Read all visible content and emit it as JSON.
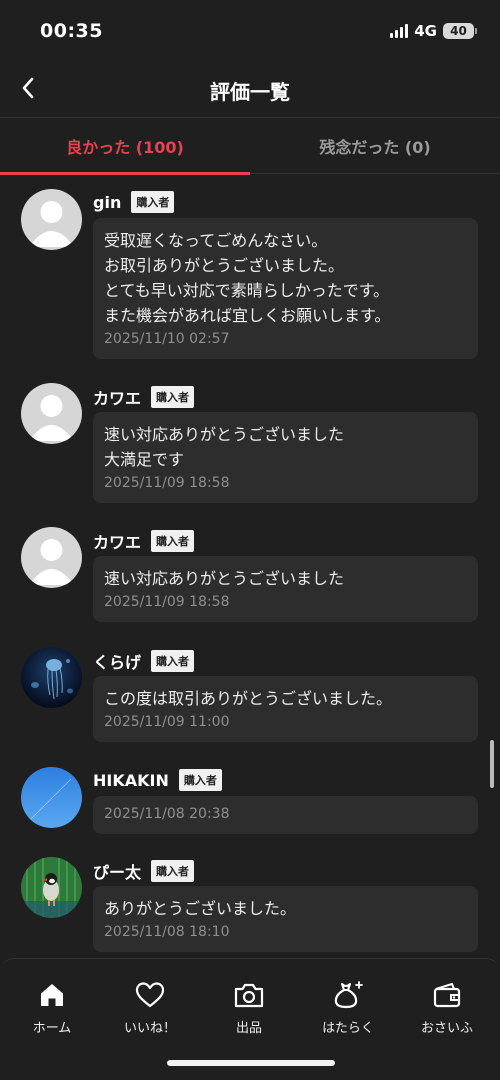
{
  "status_bar": {
    "time": "00:35",
    "network": "4G",
    "battery": "40"
  },
  "header": {
    "title": "評価一覧"
  },
  "tabs": [
    {
      "label": "良かった (100)",
      "active": true
    },
    {
      "label": "残念だった (0)",
      "active": false
    }
  ],
  "badge_label": "購入者",
  "reviews": [
    {
      "name": "gin",
      "comment": "受取遅くなってごめんなさい。\nお取引ありがとうございました。\nとても早い対応で素晴らしかったです。\nまた機会があれば宜しくお願いします。",
      "date": "2025/11/10 02:57",
      "avatar": "default-avatar"
    },
    {
      "name": "カワエ",
      "comment": "速い対応ありがとうございました\n大満足です",
      "date": "2025/11/09 18:58",
      "avatar": "default-avatar"
    },
    {
      "name": "カワエ",
      "comment": "速い対応ありがとうございました",
      "date": "2025/11/09 18:58",
      "avatar": "default-avatar"
    },
    {
      "name": "くらげ",
      "comment": "この度は取引ありがとうございました。",
      "date": "2025/11/09 11:00",
      "avatar": "jellyfish-photo"
    },
    {
      "name": "HIKAKIN",
      "comment": "",
      "date": "2025/11/08 20:38",
      "avatar": "sky-photo"
    },
    {
      "name": "ぴー太",
      "comment": "ありがとうございました。",
      "date": "2025/11/08 18:10",
      "avatar": "bird-photo"
    }
  ],
  "bottom_nav": [
    {
      "label": "ホーム",
      "icon": "home-icon"
    },
    {
      "label": "いいね！",
      "icon": "heart-icon"
    },
    {
      "label": "出品",
      "icon": "camera-icon"
    },
    {
      "label": "はたらく",
      "icon": "money-bag-icon"
    },
    {
      "label": "おさいふ",
      "icon": "wallet-icon"
    }
  ]
}
